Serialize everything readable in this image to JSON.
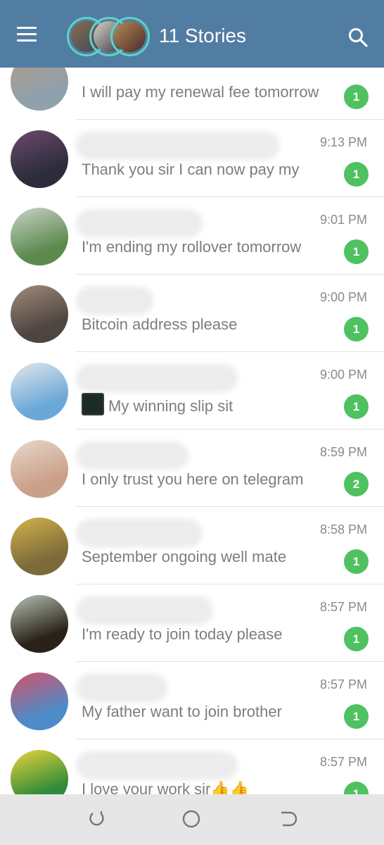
{
  "header": {
    "title": "11 Stories",
    "menu_icon": "hamburger-menu-icon",
    "search_icon": "search-icon",
    "bg_color": "#527da3"
  },
  "chats": [
    {
      "time": "",
      "message": "I will pay my renewal fee tomorrow",
      "unread": "1",
      "name_blur_width": 0,
      "avatar_colors": [
        "#8ea1ad",
        "#b39a86"
      ]
    },
    {
      "time": "9:13 PM",
      "message": "Thank you sir I can now pay my",
      "unread": "1",
      "name_blur_width": 0,
      "avatar_colors": [
        "#2c2c3a",
        "#6b4a6e"
      ]
    },
    {
      "time": "9:01 PM",
      "message": "I'm ending my rollover tomorrow",
      "unread": "1",
      "name_blur_width": 0,
      "avatar_colors": [
        "#5c8a4e",
        "#c9d3c6"
      ]
    },
    {
      "time": "9:00 PM",
      "message": "Bitcoin address please",
      "unread": "1",
      "name_blur_width": 0,
      "avatar_colors": [
        "#4e4540",
        "#a08b7a"
      ]
    },
    {
      "time": "9:00 PM",
      "message": "My winning slip sit",
      "unread": "1",
      "name_blur_width": 0,
      "avatar_colors": [
        "#6ba8d8",
        "#e3e7ea"
      ],
      "has_thumb": true
    },
    {
      "time": "8:59 PM",
      "message": "I only trust you here on telegram",
      "unread": "2",
      "name_blur_width": 0,
      "avatar_colors": [
        "#cba089",
        "#e6d7c9"
      ]
    },
    {
      "time": "8:58 PM",
      "message": "September ongoing well mate",
      "unread": "1",
      "name_blur_width": 0,
      "avatar_colors": [
        "#7c6a3b",
        "#d3b24a"
      ]
    },
    {
      "time": "8:57 PM",
      "message": "I'm ready to join today please",
      "unread": "1",
      "name_blur_width": 0,
      "avatar_colors": [
        "#2a2118",
        "#b7c3b4"
      ]
    },
    {
      "time": "8:57 PM",
      "message": "My father want to join brother",
      "unread": "1",
      "name_blur_width": 0,
      "avatar_colors": [
        "#4b8cc9",
        "#d4526a"
      ]
    },
    {
      "time": "8:57 PM",
      "message": "I love your work sir",
      "unread": "1",
      "name_blur_width": 0,
      "avatar_colors": [
        "#2f8a3a",
        "#e9d43b"
      ],
      "emoji": "👍👍"
    }
  ],
  "navbar": {
    "recents_icon": "recent-apps-icon",
    "home_icon": "home-icon",
    "back_icon": "back-icon"
  }
}
